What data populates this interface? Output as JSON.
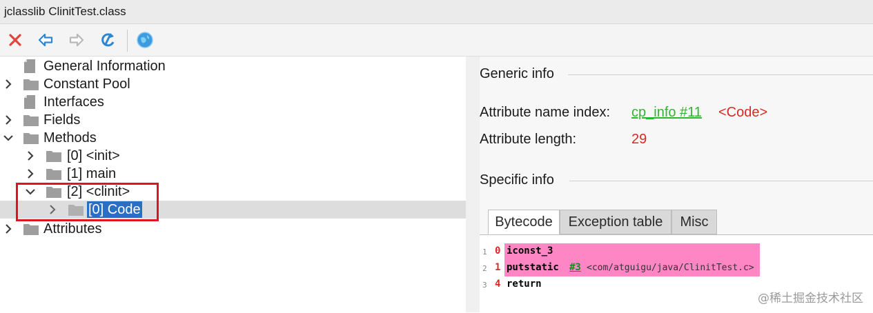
{
  "window": {
    "title": "jclasslib ClinitTest.class"
  },
  "toolbar": {
    "buttons": [
      {
        "name": "close",
        "icon": "close-icon"
      },
      {
        "name": "back",
        "icon": "arrow-left-icon"
      },
      {
        "name": "forward",
        "icon": "arrow-right-icon"
      },
      {
        "name": "reload",
        "icon": "refresh-icon"
      },
      {
        "name": "web",
        "icon": "globe-icon"
      }
    ]
  },
  "tree": {
    "items": [
      {
        "label": "General Information",
        "icon": "document-icon"
      },
      {
        "label": "Constant Pool",
        "icon": "folder-icon",
        "expander": "collapsed"
      },
      {
        "label": "Interfaces",
        "icon": "document-icon"
      },
      {
        "label": "Fields",
        "icon": "folder-icon",
        "expander": "collapsed"
      },
      {
        "label": "Methods",
        "icon": "folder-icon",
        "expander": "expanded"
      },
      {
        "label": "[0] <init>",
        "icon": "folder-icon",
        "expander": "collapsed"
      },
      {
        "label": "[1] main",
        "icon": "folder-icon",
        "expander": "collapsed"
      },
      {
        "label": "[2] <clinit>",
        "icon": "folder-icon",
        "expander": "expanded"
      },
      {
        "label": "[0] Code",
        "icon": "folder-icon",
        "expander": "collapsed",
        "selected": true
      },
      {
        "label": "Attributes",
        "icon": "folder-icon",
        "expander": "collapsed"
      }
    ]
  },
  "detail": {
    "generic_title": "Generic info",
    "attr_name_label": "Attribute name index:",
    "attr_name_link": "cp_info #11",
    "attr_name_value": "<Code>",
    "attr_length_label": "Attribute length:",
    "attr_length_value": "29",
    "specific_title": "Specific info",
    "tabs": [
      {
        "label": "Bytecode",
        "active": true
      },
      {
        "label": "Exception table",
        "active": false
      },
      {
        "label": "Misc",
        "active": false
      }
    ],
    "code": [
      {
        "line": "1",
        "pc": "0",
        "instr": "iconst_3",
        "highlighted": true
      },
      {
        "line": "2",
        "pc": "1",
        "instr": "putstatic",
        "ref": "#3",
        "comment": "<com/atguigu/java/ClinitTest.c>",
        "highlighted": true
      },
      {
        "line": "3",
        "pc": "4",
        "instr": "return",
        "highlighted": false
      }
    ]
  },
  "watermark": "@稀土掘金技术社区",
  "colors": {
    "selection": "#2a6fc4",
    "highlight_box": "#e0141e",
    "link": "#2fb52f",
    "value_red": "#d8291e",
    "code_highlight": "#ff86c4"
  }
}
